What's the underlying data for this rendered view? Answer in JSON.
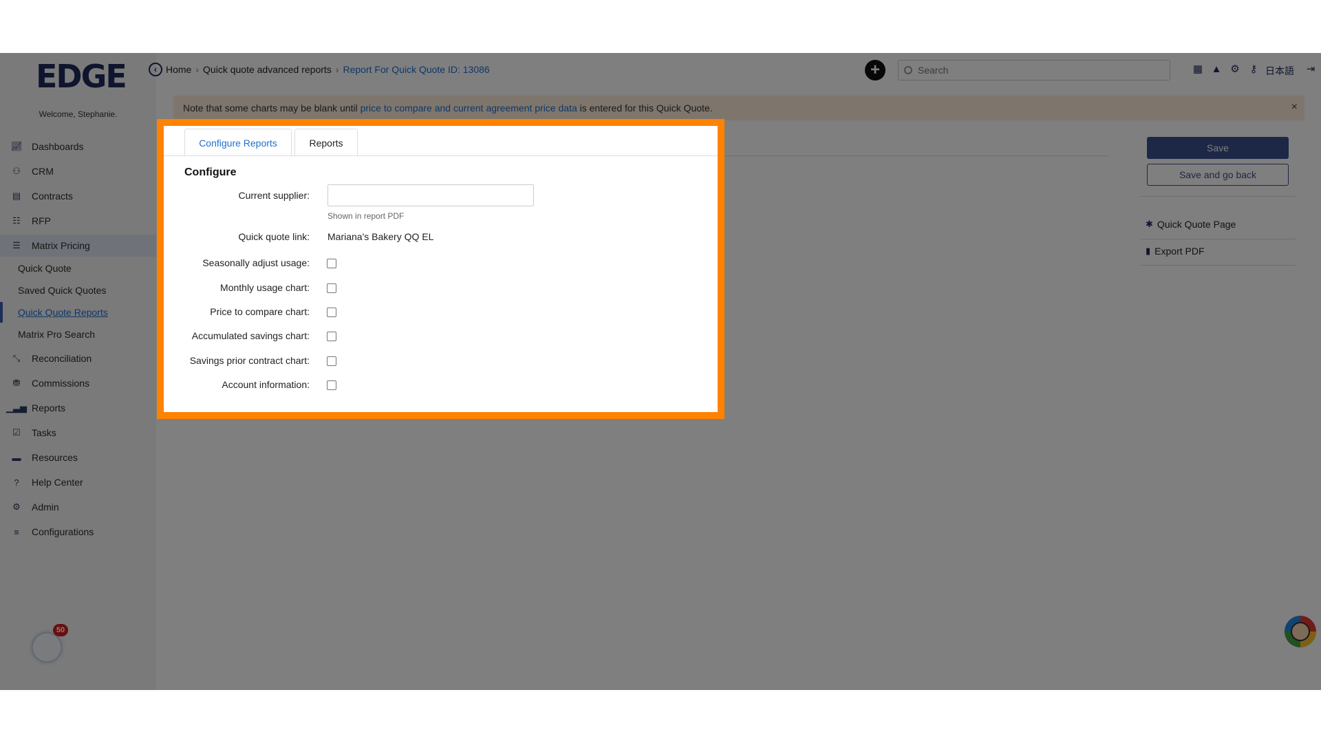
{
  "logo": "EDGE",
  "welcome": "Welcome, Stephanie.",
  "nav": [
    {
      "label": "Dashboards",
      "icon": "chart-line-icon"
    },
    {
      "label": "CRM",
      "icon": "users-icon"
    },
    {
      "label": "Contracts",
      "icon": "document-icon"
    },
    {
      "label": "RFP",
      "icon": "sitemap-icon"
    },
    {
      "label": "Matrix Pricing",
      "icon": "list-icon"
    },
    {
      "label": "Reconciliation",
      "icon": "compress-icon"
    },
    {
      "label": "Commissions",
      "icon": "coins-icon"
    },
    {
      "label": "Reports",
      "icon": "bar-chart-icon"
    },
    {
      "label": "Tasks",
      "icon": "tasks-icon"
    },
    {
      "label": "Resources",
      "icon": "folder-icon"
    },
    {
      "label": "Help Center",
      "icon": "question-icon"
    },
    {
      "label": "Admin",
      "icon": "cogs-icon"
    },
    {
      "label": "Configurations",
      "icon": "sliders-icon"
    }
  ],
  "subnav": [
    "Quick Quote",
    "Saved Quick Quotes",
    "Quick Quote Reports",
    "Matrix Pro Search"
  ],
  "badge_count": "50",
  "breadcrumb": {
    "home": "Home",
    "middle": "Quick quote advanced reports",
    "current": "Report For Quick Quote ID: 13086"
  },
  "search": {
    "placeholder": "Search"
  },
  "lang": "日本語",
  "notice": {
    "before": "Note that some charts may be blank until ",
    "link": "price to compare and current agreement price data",
    "after": " is entered for this Quick Quote.",
    "close": "×"
  },
  "tabs": {
    "configure": "Configure Reports",
    "reports": "Reports"
  },
  "form": {
    "title": "Configure",
    "current_supplier_label": "Current supplier:",
    "current_supplier_value": "",
    "current_supplier_help": "Shown in report PDF",
    "qq_link_label": "Quick quote link:",
    "qq_link_value": "Mariana's Bakery QQ EL",
    "checkboxes": [
      {
        "label": "Seasonally adjust usage:",
        "checked": false
      },
      {
        "label": "Monthly usage chart:",
        "checked": false
      },
      {
        "label": "Price to compare chart:",
        "checked": false
      },
      {
        "label": "Accumulated savings chart:",
        "checked": false
      },
      {
        "label": "Savings prior contract chart:",
        "checked": false
      },
      {
        "label": "Account information:",
        "checked": false
      }
    ]
  },
  "actions": {
    "save": "Save",
    "save_back": "Save and go back"
  },
  "panel_links": {
    "quick_quote_page": "Quick Quote Page",
    "export_pdf": "Export PDF"
  },
  "colors": {
    "highlight": "#ff8200",
    "primary": "#3a4e8c",
    "link": "#1f6fd1"
  }
}
